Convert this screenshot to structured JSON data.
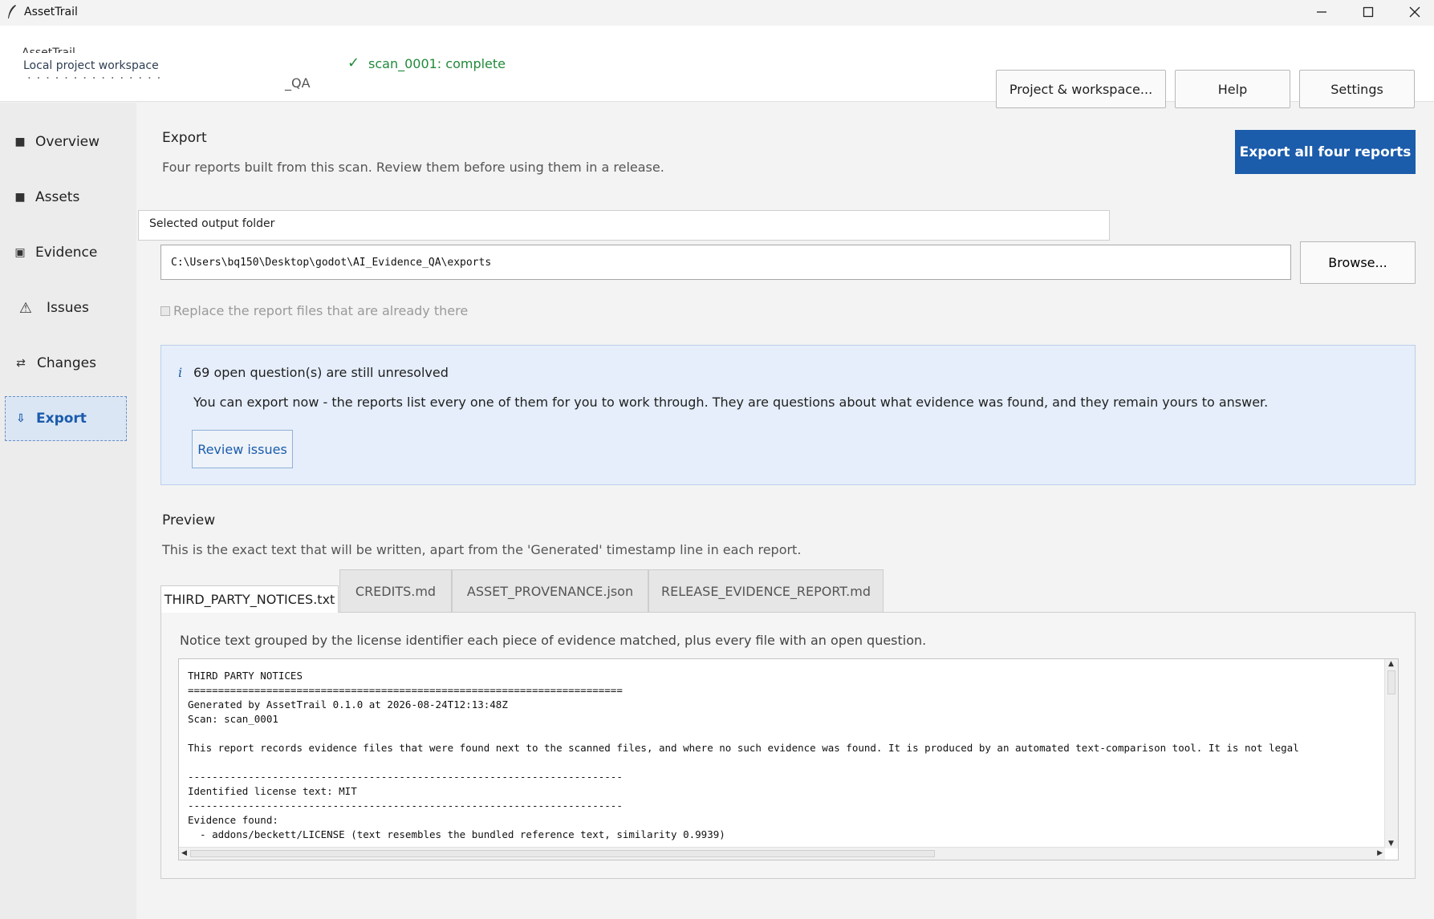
{
  "window": {
    "title": "AssetTrail",
    "controls": [
      "minimize-icon",
      "maximize-icon",
      "close-icon"
    ]
  },
  "header": {
    "project_name": "AssetTrail",
    "project_subtitle": "Local project workspace",
    "project_path_suffix": "_QA",
    "scan_status": "scan_0001: complete",
    "buttons": {
      "project": "Project & workspace...",
      "help": "Help",
      "settings": "Settings"
    }
  },
  "sidebar": {
    "items": [
      {
        "label": "Overview",
        "icon": "overview-icon"
      },
      {
        "label": "Assets",
        "icon": "assets-icon"
      },
      {
        "label": "Evidence",
        "icon": "evidence-icon"
      },
      {
        "label": "Issues",
        "icon": "warning-icon"
      },
      {
        "label": "Changes",
        "icon": "changes-icon"
      },
      {
        "label": "Export",
        "icon": "export-icon",
        "active": true
      }
    ]
  },
  "export": {
    "title": "Export",
    "description": "Four reports built from this scan. Review them before using them in a release.",
    "export_all_label": "Export all four reports",
    "folder_label": "Selected output folder",
    "folder_value": "C:\\Users\\bq150\\Desktop\\godot\\AI_Evidence_QA\\exports",
    "browse_label": "Browse...",
    "replace_label": "Replace the report files that are already there",
    "replace_checked": false
  },
  "notice": {
    "icon": "i",
    "title": "69 open question(s) are still unresolved",
    "body": "You can export now - the reports list every one of them for you to work through. They are questions about what evidence was found, and they remain yours to answer.",
    "button": "Review issues"
  },
  "preview": {
    "title": "Preview",
    "description": "This is the exact text that will be written, apart from the 'Generated' timestamp line in each report.",
    "tabs": [
      {
        "label": "THIRD_PARTY_NOTICES.txt",
        "active": true
      },
      {
        "label": "CREDITS.md"
      },
      {
        "label": "ASSET_PROVENANCE.json"
      },
      {
        "label": "RELEASE_EVIDENCE_REPORT.md"
      }
    ],
    "tab_description": "Notice text grouped by the license identifier each piece of evidence matched, plus every file with an open question.",
    "text": "THIRD PARTY NOTICES\n========================================================================\nGenerated by AssetTrail 0.1.0 at 2026-08-24T12:13:48Z\nScan: scan_0001\n\nThis report records evidence files that were found next to the scanned files, and where no such evidence was found. It is produced by an automated text-comparison tool. It is not legal\n\n------------------------------------------------------------------------\nIdentified license text: MIT\n------------------------------------------------------------------------\nEvidence found:\n  - addons/beckett/LICENSE (text resembles the bundled reference text, similarity 0.9939)"
  },
  "colors": {
    "accent": "#1b5cab",
    "success": "#218a3a",
    "info_bg": "#e5eefa"
  }
}
